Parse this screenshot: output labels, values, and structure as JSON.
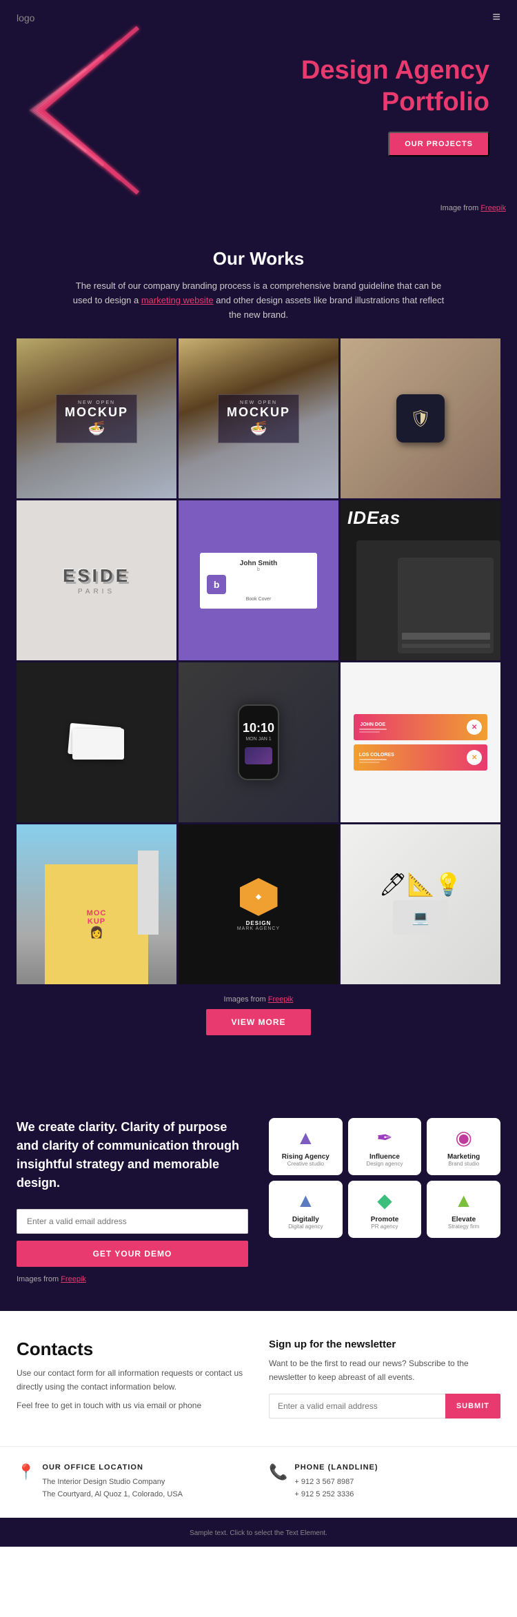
{
  "header": {
    "logo": "logo",
    "hamburger": "≡"
  },
  "hero": {
    "title_line1": "Design Agency",
    "title_line2": "Portfolio",
    "cta_label": "OUR PROJECTS",
    "credit_text": "Image from",
    "credit_link": "Freepik"
  },
  "works": {
    "title": "Our Works",
    "description": "The result of our company branding process is a comprehensive brand guideline that can be used to design a",
    "desc_link": "marketing website",
    "desc_suffix": " and other design assets like brand illustrations that reflect the new brand.",
    "caption_text": "Images from",
    "caption_link": "Freepik",
    "view_more_label": "VIEW MORE",
    "grid_items": [
      {
        "id": "mockup-billboard-1",
        "type": "mockup-billboard",
        "label": "MOCKUP",
        "small": "NEW OPEN"
      },
      {
        "id": "mockup-billboard-2",
        "type": "mockup-billboard",
        "label": "MOCKUP",
        "small": "NEW OPEN"
      },
      {
        "id": "signage",
        "type": "signage",
        "label": ""
      },
      {
        "id": "eside",
        "type": "eside",
        "label": "ESIDE",
        "sub": "PARIS"
      },
      {
        "id": "bookcover",
        "type": "bookcover",
        "label": "John Smith Book Cover"
      },
      {
        "id": "ideas",
        "type": "ideas",
        "label": "IDEas"
      },
      {
        "id": "cards",
        "type": "cards",
        "label": ""
      },
      {
        "id": "phone",
        "type": "phone",
        "time": "10:10",
        "date": "MON JAN 1"
      },
      {
        "id": "bizcard",
        "type": "bizcard",
        "name": "JOHN DOE",
        "sub": "LOS COLORES"
      },
      {
        "id": "mockup-city",
        "type": "mockup-city",
        "label": "MOCKUP"
      },
      {
        "id": "biz2",
        "type": "biz2",
        "label": "DESIGN",
        "sub": "MARK AGENCY"
      },
      {
        "id": "desk",
        "type": "desk",
        "label": ""
      }
    ]
  },
  "clarity": {
    "heading": "We create clarity. Clarity of purpose and clarity of communication through insightful strategy and memorable design.",
    "email_placeholder": "Enter a valid email address",
    "demo_label": "GET YOUR DEMO",
    "credit_text": "Images from",
    "credit_link": "Freepik",
    "logos": [
      {
        "id": "rising",
        "name": "Rising Agency",
        "tagline": "Creative studio",
        "icon": "▲",
        "color": "#7c5cbf"
      },
      {
        "id": "influence",
        "name": "Influence",
        "tagline": "Design agency",
        "icon": "✒",
        "color": "#9c3cbf"
      },
      {
        "id": "marketing",
        "name": "Marketing",
        "tagline": "Brand studio",
        "icon": "◉",
        "color": "#bf3c9c"
      },
      {
        "id": "digitally",
        "name": "Digitally",
        "tagline": "Digital agency",
        "icon": "▲",
        "color": "#5c7cbf"
      },
      {
        "id": "promote",
        "name": "Promote",
        "tagline": "PR agency",
        "icon": "◆",
        "color": "#3cbf7c"
      },
      {
        "id": "elevate",
        "name": "Elevate",
        "tagline": "Strategy firm",
        "icon": "▲",
        "color": "#7cbf3c"
      }
    ]
  },
  "contacts": {
    "title": "Contacts",
    "desc1": "Use our contact form for all information requests or contact us directly using the contact information below.",
    "desc2": "Feel free to get in touch with us via email or phone",
    "newsletter_title": "Sign up for the newsletter",
    "newsletter_desc": "Want to be the first to read our news? Subscribe to the newsletter to keep abreast of all events.",
    "newsletter_placeholder": "Enter a valid email address",
    "newsletter_submit": "SUBMIT"
  },
  "footer": {
    "office_icon": "📍",
    "office_title": "OUR OFFICE LOCATION",
    "office_line1": "The Interior Design Studio Company",
    "office_line2": "The Courtyard, Al Quoz 1, Colorado,  USA",
    "phone_icon": "📞",
    "phone_title": "PHONE (LANDLINE)",
    "phone_line1": "+ 912 3 567 8987",
    "phone_line2": "+ 912 5 252 3336",
    "footer_bar_text": "Sample text. Click to select the Text Element."
  }
}
